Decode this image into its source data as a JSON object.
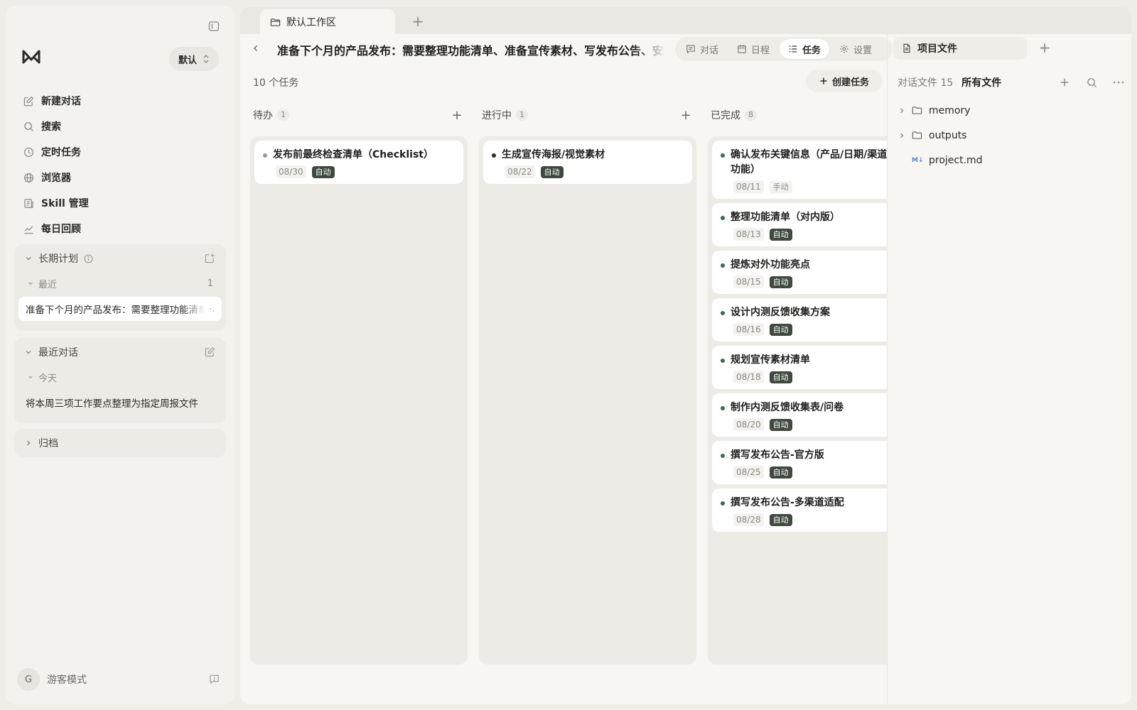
{
  "sidebar": {
    "profile": "默认",
    "nav": [
      {
        "label": "新建对话",
        "icon": "edit-icon"
      },
      {
        "label": "搜索",
        "icon": "search-icon"
      },
      {
        "label": "定时任务",
        "icon": "clock-icon"
      },
      {
        "label": "浏览器",
        "icon": "globe-icon"
      },
      {
        "label": "Skill 管理",
        "icon": "skill-icon"
      },
      {
        "label": "每日回顾",
        "icon": "chart-icon"
      }
    ],
    "long_plan": {
      "title": "长期计划",
      "group": "最近",
      "group_count": "1",
      "item": "准备下个月的产品发布：需要整理功能清单、准备宣传素材、写发布公告"
    },
    "recent": {
      "title": "最近对话",
      "group": "今天",
      "item": "将本周三项工作要点整理为指定周报文件"
    },
    "archive": {
      "title": "归档"
    },
    "footer": {
      "avatar": "G",
      "mode": "游客模式"
    }
  },
  "tabs": [
    {
      "label": "默认工作区"
    }
  ],
  "header": {
    "title": "准备下个月的产品发布：需要整理功能清单、准备宣传素材、写发布公告、安排内测",
    "segments": [
      {
        "label": "对话",
        "icon": "chat-icon",
        "active": false
      },
      {
        "label": "日程",
        "icon": "calendar-icon",
        "active": false
      },
      {
        "label": "任务",
        "icon": "tasks-icon",
        "active": true
      },
      {
        "label": "设置",
        "icon": "gear-icon",
        "active": false
      }
    ]
  },
  "board": {
    "count_label": "10 个任务",
    "create_label": "创建任务",
    "columns": [
      {
        "name": "待办",
        "count": "1",
        "dot_color": "#9a9994",
        "cards": [
          {
            "title": "发布前最终检查清单（Checklist）",
            "date": "08/30",
            "badge": "自动"
          }
        ]
      },
      {
        "name": "进行中",
        "count": "1",
        "dot_color": "#2b2b29",
        "cards": [
          {
            "title": "生成宣传海报/视觉素材",
            "date": "08/22",
            "badge": "自动"
          }
        ]
      },
      {
        "name": "已完成",
        "count": "8",
        "dot_color": "#3f6b4a",
        "cards": [
          {
            "title": "确认发布关键信息（产品/日期/渠道/核心功能）",
            "date": "08/11",
            "badge": "手动"
          },
          {
            "title": "整理功能清单（对内版）",
            "date": "08/13",
            "badge": "自动"
          },
          {
            "title": "提炼对外功能亮点",
            "date": "08/15",
            "badge": "自动"
          },
          {
            "title": "设计内测反馈收集方案",
            "date": "08/16",
            "badge": "自动"
          },
          {
            "title": "规划宣传素材清单",
            "date": "08/18",
            "badge": "自动"
          },
          {
            "title": "制作内测反馈收集表/问卷",
            "date": "08/20",
            "badge": "自动"
          },
          {
            "title": "撰写发布公告-官方版",
            "date": "08/25",
            "badge": "自动"
          },
          {
            "title": "撰写发布公告-多渠道适配",
            "date": "08/28",
            "badge": "自动"
          }
        ]
      }
    ]
  },
  "files": {
    "tab_label": "项目文件",
    "conv_files_label": "对话文件 15",
    "all_files_label": "所有文件",
    "tree": [
      {
        "name": "memory",
        "type": "folder"
      },
      {
        "name": "outputs",
        "type": "folder"
      },
      {
        "name": "project.md",
        "type": "markdown"
      }
    ]
  }
}
